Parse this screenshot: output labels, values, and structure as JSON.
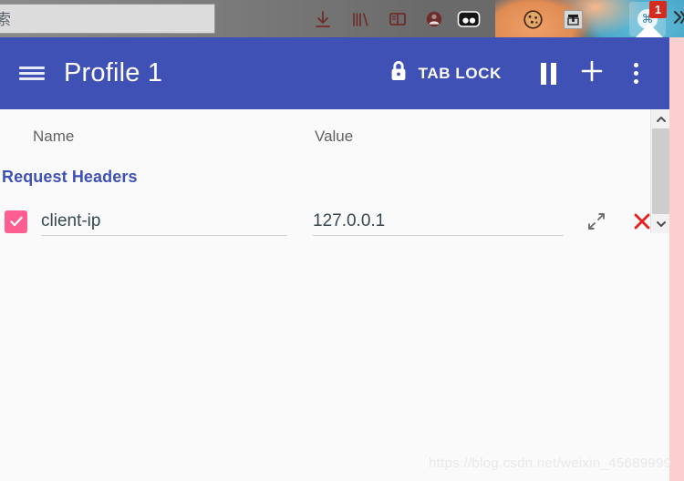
{
  "browser": {
    "urlbar": {
      "value": "索",
      "placeholder": ""
    },
    "toolbar_icons": [
      {
        "name": "downloads-icon",
        "glyph": "download-arrow"
      },
      {
        "name": "library-icon",
        "glyph": "books"
      },
      {
        "name": "sidebar-icon",
        "glyph": "panel"
      },
      {
        "name": "account-icon",
        "glyph": "person-circle"
      },
      {
        "name": "extension-dualcircle-icon",
        "glyph": "two-dots"
      },
      {
        "name": "devtools-code-icon",
        "glyph": "</>"
      },
      {
        "name": "cookie-editor-icon",
        "glyph": "cookie"
      },
      {
        "name": "tab-chest-icon",
        "glyph": "chest"
      }
    ],
    "active_extension": {
      "name": "modheader-extension-icon",
      "badge": "1"
    },
    "overflow": {
      "name": "overflow-chevron-icon",
      "glyph": "»"
    }
  },
  "header": {
    "menu_label": "menu",
    "title": "Profile 1",
    "tab_lock_label": "TAB LOCK",
    "pause_label": "pause",
    "add_label": "+",
    "more_label": "more options"
  },
  "panel": {
    "columns": {
      "name": "Name",
      "value": "Value"
    },
    "section_title": "Request Headers",
    "rows": [
      {
        "enabled": true,
        "name": "client-ip",
        "value": "127.0.0.1",
        "name_placeholder": "Name",
        "value_placeholder": "Value"
      }
    ],
    "row_actions": {
      "expand_label": "expand",
      "delete_label": "delete"
    }
  },
  "scrollbar": {
    "up_label": "scroll up",
    "down_label": "scroll down"
  },
  "watermark": "https://blog.csdn.net/weixin_45689999",
  "colors": {
    "header_blue": "#3f51b5",
    "section_blue": "#3f51b5",
    "checkbox_pink": "#ff5e91",
    "delete_red": "#ea1c1c",
    "badge_red": "#d52b1e",
    "page_edge_pink": "#fbcfcf",
    "panel_background": "#fafafa"
  }
}
